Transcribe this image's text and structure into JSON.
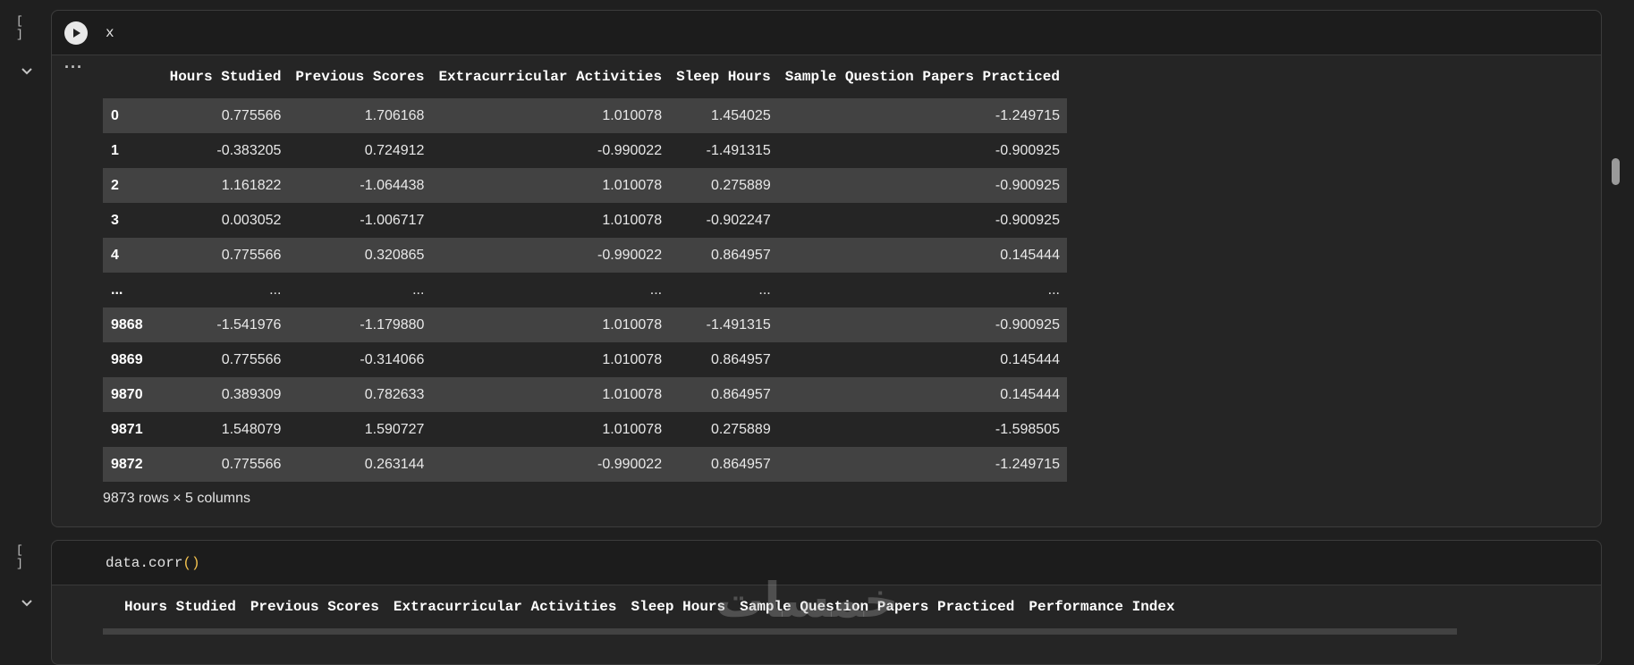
{
  "cells": [
    {
      "bracket": "[ ]",
      "code": "x",
      "output": {
        "columns": [
          "",
          "Hours Studied",
          "Previous Scores",
          "Extracurricular Activities",
          "Sleep Hours",
          "Sample Question Papers Practiced"
        ],
        "rows": [
          [
            "0",
            "0.775566",
            "1.706168",
            "1.010078",
            "1.454025",
            "-1.249715"
          ],
          [
            "1",
            "-0.383205",
            "0.724912",
            "-0.990022",
            "-1.491315",
            "-0.900925"
          ],
          [
            "2",
            "1.161822",
            "-1.064438",
            "1.010078",
            "0.275889",
            "-0.900925"
          ],
          [
            "3",
            "0.003052",
            "-1.006717",
            "1.010078",
            "-0.902247",
            "-0.900925"
          ],
          [
            "4",
            "0.775566",
            "0.320865",
            "-0.990022",
            "0.864957",
            "0.145444"
          ],
          [
            "...",
            "...",
            "...",
            "...",
            "...",
            "..."
          ],
          [
            "9868",
            "-1.541976",
            "-1.179880",
            "1.010078",
            "-1.491315",
            "-0.900925"
          ],
          [
            "9869",
            "0.775566",
            "-0.314066",
            "1.010078",
            "0.864957",
            "0.145444"
          ],
          [
            "9870",
            "0.389309",
            "0.782633",
            "1.010078",
            "0.864957",
            "0.145444"
          ],
          [
            "9871",
            "1.548079",
            "1.590727",
            "1.010078",
            "0.275889",
            "-1.598505"
          ],
          [
            "9872",
            "0.775566",
            "0.263144",
            "-0.990022",
            "0.864957",
            "-1.249715"
          ]
        ],
        "shape": "9873 rows × 5 columns"
      }
    },
    {
      "bracket": "[ ]",
      "code_fn": "data.corr",
      "code_parens": "()",
      "output": {
        "columns": [
          "",
          "Hours Studied",
          "Previous Scores",
          "Extracurricular Activities",
          "Sleep Hours",
          "Sample Question Papers Practiced",
          "Performance Index"
        ]
      }
    }
  ],
  "watermark": "خمسات",
  "icons": {
    "run": "play-icon",
    "collapse": "chevron-down-icon",
    "output_menu": "more-horizontal-icon"
  }
}
